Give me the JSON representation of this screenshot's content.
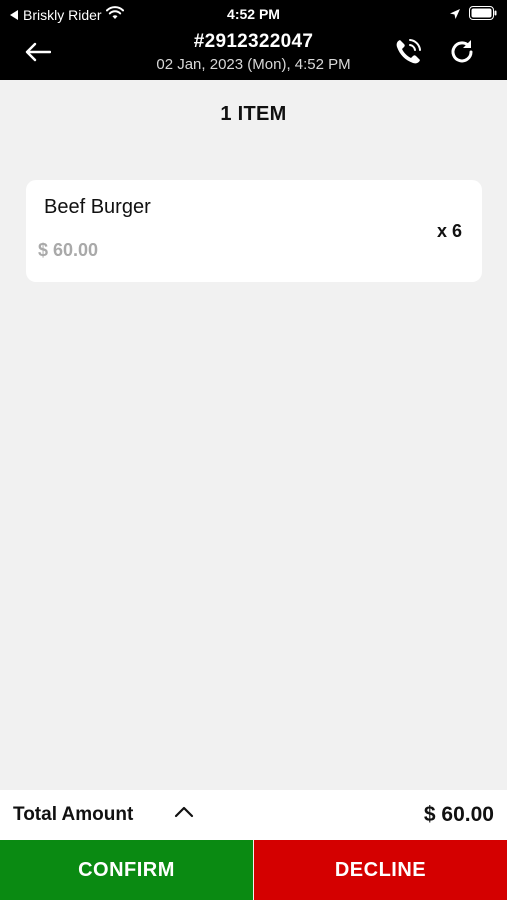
{
  "status_bar": {
    "back_app": "Briskly Rider",
    "time": "4:52 PM"
  },
  "header": {
    "order_number": "#2912322047",
    "order_datetime": "02 Jan, 2023 (Mon),  4:52 PM"
  },
  "items_section": {
    "count_label": "1 ITEM",
    "items": [
      {
        "name": "Beef Burger",
        "price": "$ 60.00",
        "quantity": "x 6"
      }
    ]
  },
  "footer": {
    "total_label": "Total Amount",
    "total_amount": "$ 60.00",
    "confirm_label": "CONFIRM",
    "decline_label": "DECLINE"
  },
  "colors": {
    "confirm": "#0a8a12",
    "decline": "#d40000",
    "header_bg": "#000000",
    "page_bg": "#f1f1f1"
  },
  "icons": [
    "back-triangle-icon",
    "wifi-icon",
    "location-arrow-icon",
    "battery-icon",
    "back-arrow-icon",
    "phone-call-icon",
    "refresh-icon",
    "chevron-up-icon"
  ]
}
